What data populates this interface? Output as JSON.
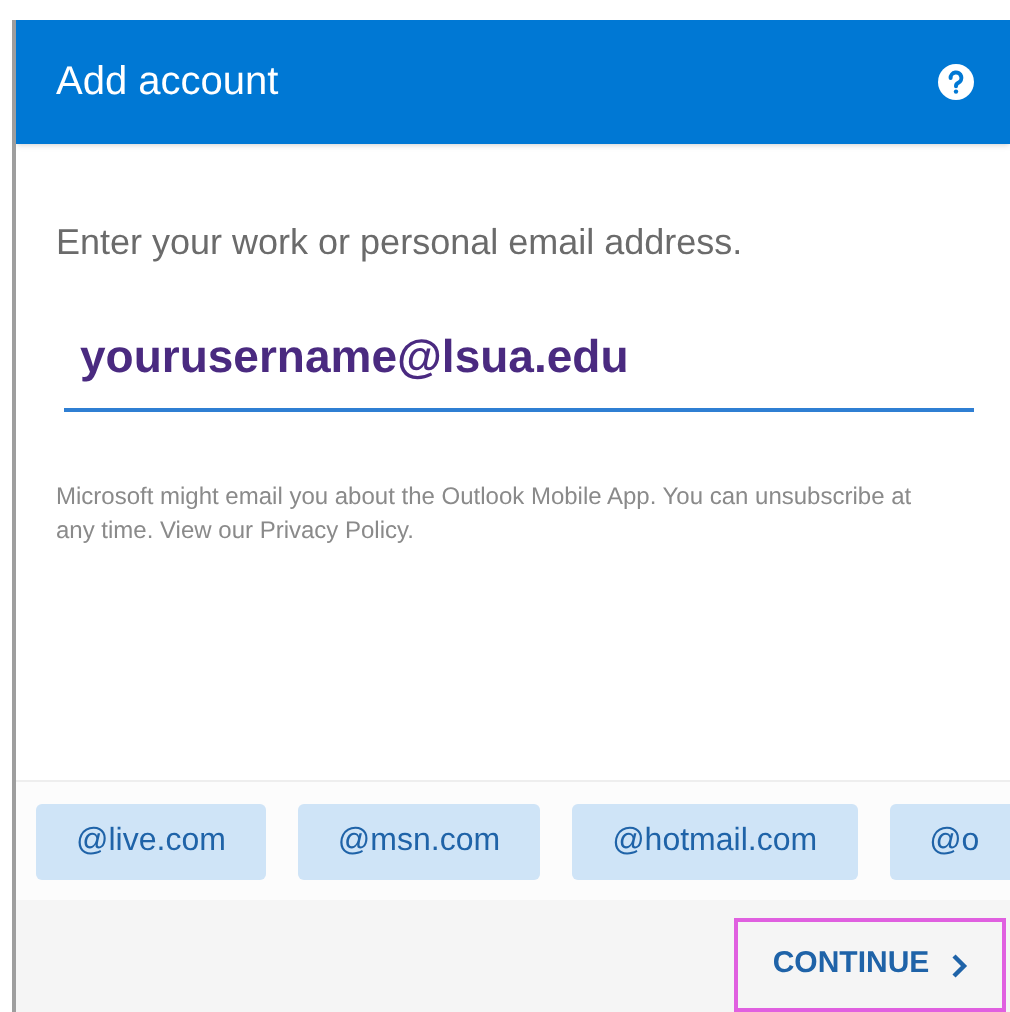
{
  "header": {
    "title": "Add account"
  },
  "prompt": "Enter your work or personal email address.",
  "email_field": {
    "value": "yourusername@lsua.edu"
  },
  "disclaimer": "Microsoft might email you about the Outlook Mobile App. You can unsubscribe at any time. View our Privacy Policy.",
  "domain_suggestions": [
    "@live.com",
    "@msn.com",
    "@hotmail.com",
    "@o"
  ],
  "continue_button": {
    "label": "CONTINUE",
    "highlighted": true
  }
}
